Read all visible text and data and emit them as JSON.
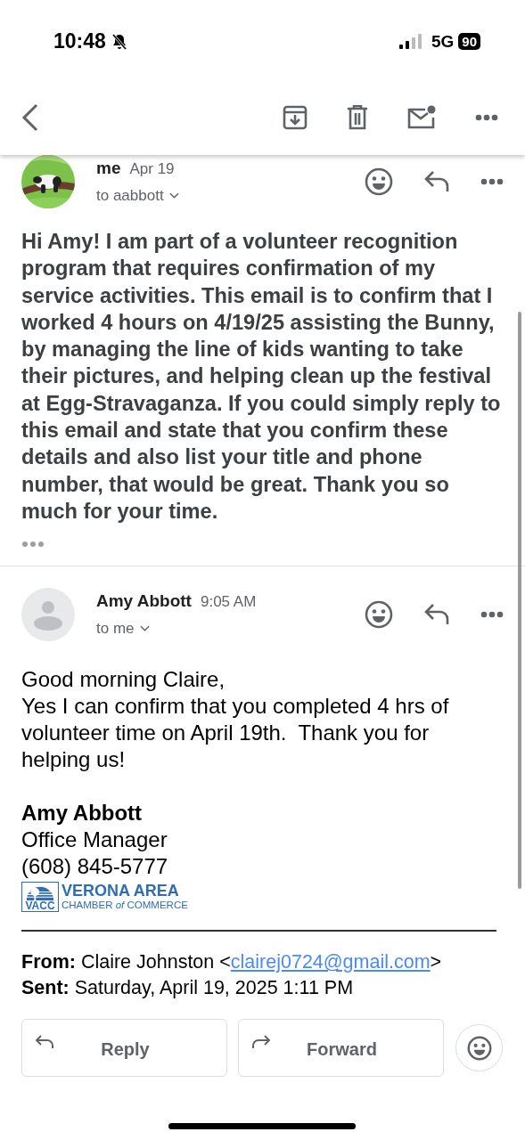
{
  "status_bar": {
    "time": "10:48",
    "network": "5G",
    "battery": "90"
  },
  "messages": [
    {
      "sender": "me",
      "time": "Apr 19",
      "recipient": "to aabbott",
      "kind": "photo_avatar",
      "body": [
        "Hi Amy! I am part of a volunteer recognition program that requires confirmation of my service activities. This email is to confirm that I worked 4 hours on 4/19/25 assisting the Bunny, by managing the line of kids wanting to take their pictures, and helping clean up the festival at Egg-Stravaganza. If you could simply reply to this email and state that you confirm these details and also list your title and phone number, that would be great. Thank you so much for your time."
      ]
    },
    {
      "sender": "Amy Abbott",
      "time": "9:05 AM",
      "recipient": "to me",
      "kind": "default_avatar",
      "body": [
        "Good morning Claire,",
        "Yes I can confirm that you completed 4 hrs of volunteer time on April 19th.  Thank you for helping us!"
      ]
    }
  ],
  "signature": {
    "name": "Amy Abbott",
    "title": "Office Manager",
    "phone": "(608) 845-5777",
    "logo": {
      "title": "VERONA AREA",
      "abbr": "VACC",
      "subtitle": "CHAMBER *of* COMMERCE"
    }
  },
  "forwarded": {
    "from_label": "From:",
    "from_name": "Claire Johnston <",
    "email": "clairej0724@gmail.com",
    "from_end": ">",
    "sent_label": "Sent:",
    "sent": "Saturday, April 19, 2025 1:11 PM"
  },
  "actions": [
    {
      "label": "Reply",
      "kind": "reply"
    },
    {
      "label": "Forward",
      "kind": "forward"
    }
  ]
}
